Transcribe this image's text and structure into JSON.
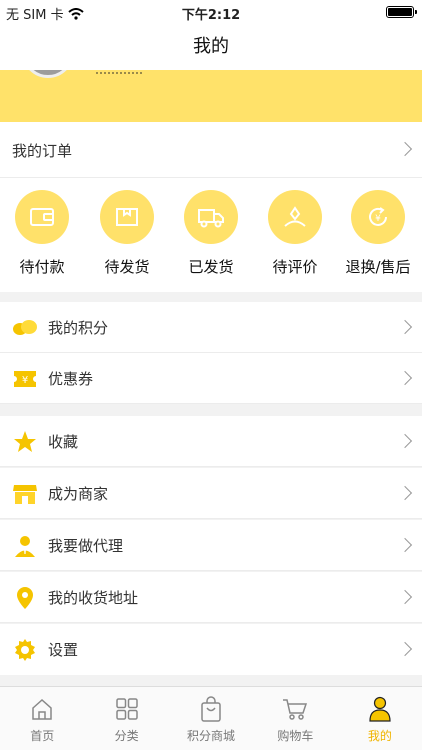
{
  "status_bar": {
    "carrier": "无 SIM 卡",
    "time": "下午2:12"
  },
  "nav": {
    "title": "我的"
  },
  "orders": {
    "header": "我的订单",
    "statuses": [
      {
        "label": "待付款",
        "icon": "wallet-icon"
      },
      {
        "label": "待发货",
        "icon": "box-icon"
      },
      {
        "label": "已发货",
        "icon": "truck-icon"
      },
      {
        "label": "待评价",
        "icon": "review-icon"
      },
      {
        "label": "退换/售后",
        "icon": "refund-icon"
      }
    ]
  },
  "menu": {
    "points": "我的积分",
    "coupons": "优惠券",
    "favorites": "收藏",
    "merchant": "成为商家",
    "agent": "我要做代理",
    "address": "我的收货地址",
    "settings": "设置"
  },
  "tabbar": {
    "items": [
      {
        "label": "首页",
        "icon": "home-icon"
      },
      {
        "label": "分类",
        "icon": "category-icon"
      },
      {
        "label": "积分商城",
        "icon": "points-mall-icon"
      },
      {
        "label": "购物车",
        "icon": "cart-icon"
      },
      {
        "label": "我的",
        "icon": "user-icon"
      }
    ],
    "active": "我的"
  },
  "colors": {
    "accent": "#ffe26a",
    "icon": "#f5c400",
    "active_tab": "#f0b400"
  }
}
